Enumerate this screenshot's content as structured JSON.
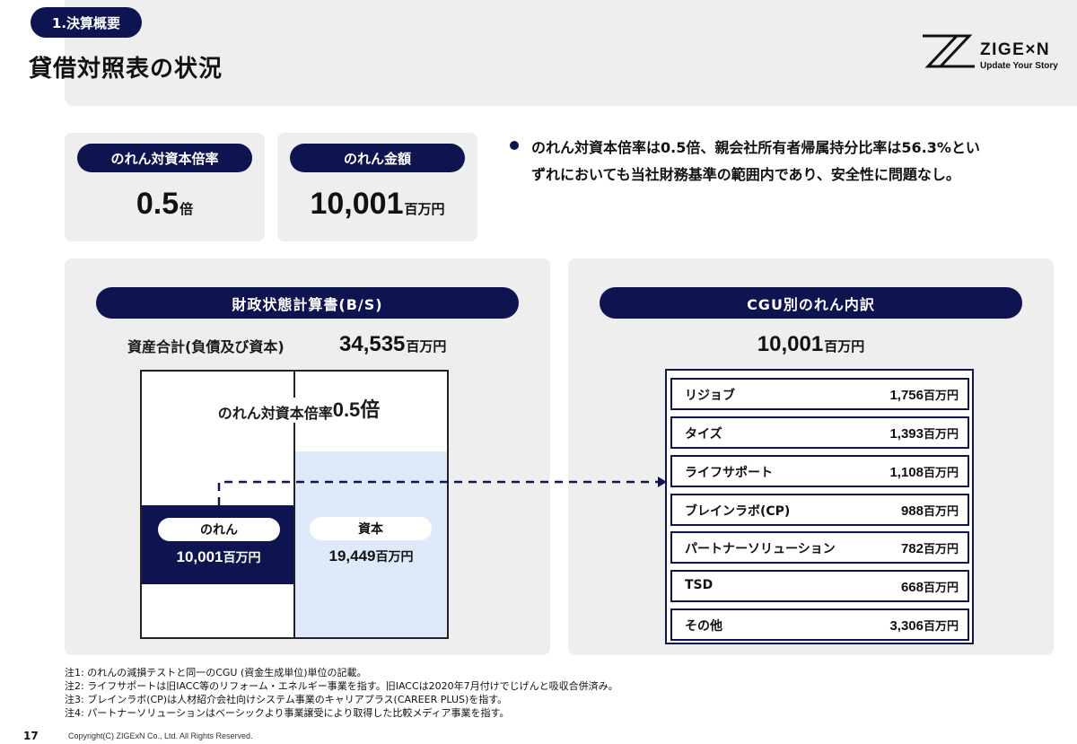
{
  "header": {
    "section_label": "1.決算概要",
    "title": "貸借対照表の状況",
    "logo_text": "ZIGE×N",
    "logo_tagline": "Update Your Story"
  },
  "kpis": [
    {
      "label": "のれん対資本倍率",
      "value": "0.5",
      "unit": "倍"
    },
    {
      "label": "のれん金額",
      "value": "10,001",
      "unit": "百万円"
    }
  ],
  "summary": {
    "line1": "のれん対資本倍率は0.5倍、親会社所有者帰属持分比率は56.3%とい",
    "line2": "ずれにおいても当社財務基準の範囲内であり、安全性に問題なし。"
  },
  "bs_panel": {
    "title": "財政状態計算書(B/S)",
    "total_label": "資産合計(負債及び資本)",
    "total_value": "34,535",
    "total_unit": "百万円",
    "ratio_label": "のれん対資本倍率",
    "ratio_value": "0.5倍",
    "goodwill": {
      "label": "のれん",
      "value": "10,001",
      "unit": "百万円"
    },
    "equity": {
      "label": "資本",
      "value": "19,449",
      "unit": "百万円"
    }
  },
  "cgu_panel": {
    "title": "CGU別のれん内訳",
    "total_value": "10,001",
    "total_unit": "百万円",
    "rows": [
      {
        "name": "リジョブ",
        "value": "1,756",
        "unit": "百万円"
      },
      {
        "name": "タイズ",
        "value": "1,393",
        "unit": "百万円"
      },
      {
        "name": "ライフサポート",
        "value": "1,108",
        "unit": "百万円"
      },
      {
        "name": "ブレインラボ(CP)",
        "value": "988",
        "unit": "百万円"
      },
      {
        "name": "パートナーソリューション",
        "value": "782",
        "unit": "百万円"
      },
      {
        "name": "TSD",
        "value": "668",
        "unit": "百万円"
      },
      {
        "name": "その他",
        "value": "3,306",
        "unit": "百万円"
      }
    ]
  },
  "notes": [
    "注1: のれんの減損テストと同一のCGU (資金生成単位)単位の記載。",
    "注2: ライフサポートは旧IACC等のリフォーム・エネルギー事業を指す。旧IACCは2020年7月付けでじげんと吸収合併済み。",
    "注3: ブレインラボ(CP)は人材紹介会社向けシステム事業のキャリアプラス(CAREER PLUS)を指す。",
    "注4: パートナーソリューションはベーシックより事業譲受により取得した比較メディア事業を指す。"
  ],
  "footer": {
    "page_number": "17",
    "copyright": "Copyright(C) ZIGExN Co., Ltd. All Rights Reserved."
  },
  "colors": {
    "navy": "#0e1450",
    "panel_gray": "#eeeeee",
    "equity_blue": "#deeaf9"
  }
}
